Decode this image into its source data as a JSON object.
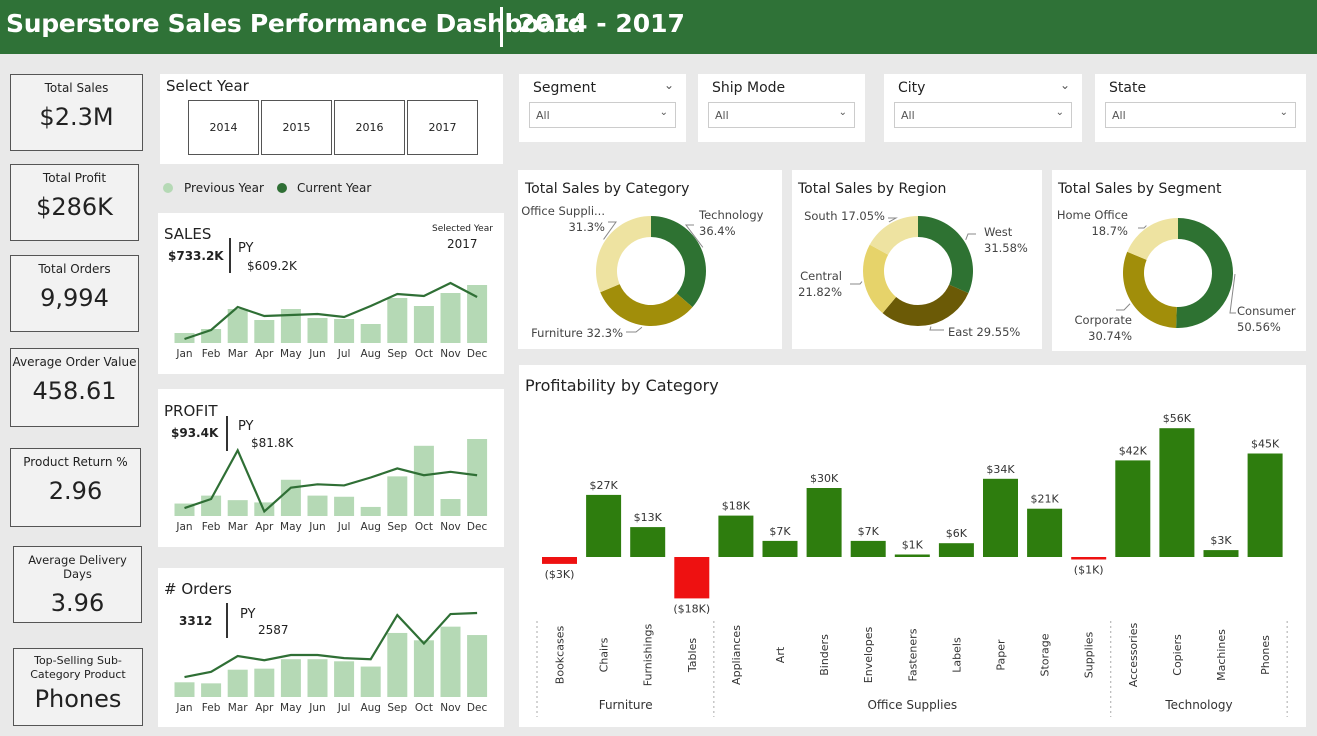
{
  "header": {
    "title": "Superstore Sales Performance Dashboard",
    "years": "2014 - 2017"
  },
  "kpis": [
    {
      "label": "Total Sales",
      "value": "$2.3M"
    },
    {
      "label": "Total Profit",
      "value": "$286K"
    },
    {
      "label": "Total Orders",
      "value": "9,994"
    },
    {
      "label": "Average Order Value",
      "value": "458.61"
    },
    {
      "label": "Product Return %",
      "value": "2.96"
    },
    {
      "label": "Average Delivery Days",
      "value": "3.96"
    },
    {
      "label": "Top-Selling Sub-Category Product",
      "value": "Phones"
    }
  ],
  "year_select": {
    "title": "Select Year",
    "years": [
      "2014",
      "2015",
      "2016",
      "2017"
    ]
  },
  "legend": {
    "previous": "Previous Year",
    "current": "Current Year",
    "previous_color": "#b5d9b5",
    "current_color": "#2f6f35"
  },
  "filters": [
    {
      "label": "Segment",
      "value": "All"
    },
    {
      "label": "Ship Mode",
      "value": "All"
    },
    {
      "label": "City",
      "value": "All"
    },
    {
      "label": "State",
      "value": "All"
    }
  ],
  "monthly": {
    "months": [
      "Jan",
      "Feb",
      "Mar",
      "Apr",
      "May",
      "Jun",
      "Jul",
      "Aug",
      "Sep",
      "Oct",
      "Nov",
      "Dec"
    ],
    "sales": {
      "title": "SALES",
      "current": "$733.2K",
      "py_label": "PY",
      "py": "$609.2K",
      "selected_label": "Selected Year",
      "selected": "2017",
      "bars": [
        10,
        14,
        34,
        23,
        34,
        25,
        24,
        19,
        45,
        37,
        50,
        58
      ],
      "line": [
        4,
        13,
        36,
        27,
        28,
        29,
        26,
        37,
        49,
        47,
        60,
        46
      ]
    },
    "profit": {
      "title": "PROFIT",
      "current": "$93.4K",
      "py_label": "PY",
      "py": "$81.8K",
      "bars": [
        11,
        18,
        14,
        12,
        32,
        18,
        17,
        8,
        35,
        62,
        15,
        68
      ],
      "line": [
        7,
        15,
        58,
        4,
        25,
        28,
        27,
        34,
        42,
        36,
        39,
        36
      ]
    },
    "orders": {
      "title": "# Orders",
      "current": "3312",
      "py_label": "PY",
      "py": "2587",
      "bars": [
        14,
        13,
        26,
        27,
        36,
        36,
        34,
        29,
        61,
        54,
        67,
        59
      ],
      "line": [
        19,
        24,
        39,
        35,
        40,
        40,
        37,
        36,
        78,
        51,
        79,
        80
      ]
    }
  },
  "chart_data": [
    {
      "type": "pie",
      "title": "Total Sales by Category",
      "slices": [
        {
          "label": "Technology",
          "pct": 36.4,
          "color": "#2e7232"
        },
        {
          "label": "Furniture",
          "pct": 32.3,
          "color": "#a18e0a"
        },
        {
          "label": "Office Suppli...",
          "pct": 31.3,
          "color": "#eee3a1"
        }
      ]
    },
    {
      "type": "pie",
      "title": "Total Sales by Region",
      "slices": [
        {
          "label": "West",
          "pct": 31.58,
          "color": "#2e7232"
        },
        {
          "label": "East",
          "pct": 29.55,
          "color": "#6b5a06"
        },
        {
          "label": "Central",
          "pct": 21.82,
          "color": "#e6d36a"
        },
        {
          "label": "South",
          "pct": 17.05,
          "color": "#eee3a1"
        }
      ]
    },
    {
      "type": "pie",
      "title": "Total Sales by Segment",
      "slices": [
        {
          "label": "Consumer",
          "pct": 50.56,
          "color": "#2e7232"
        },
        {
          "label": "Corporate",
          "pct": 30.74,
          "color": "#a18e0a"
        },
        {
          "label": "Home Office",
          "pct": 18.7,
          "color": "#eee3a1"
        }
      ]
    },
    {
      "type": "bar",
      "title": "Profitability by Category",
      "categories": [
        "Bookcases",
        "Chairs",
        "Furnishings",
        "Tables",
        "Appliances",
        "Art",
        "Binders",
        "Envelopes",
        "Fasteners",
        "Labels",
        "Paper",
        "Storage",
        "Supplies",
        "Accessories",
        "Copiers",
        "Machines",
        "Phones"
      ],
      "groups": [
        {
          "name": "Furniture",
          "count": 4
        },
        {
          "name": "Office Supplies",
          "count": 9
        },
        {
          "name": "Technology",
          "count": 4
        }
      ],
      "values": [
        -3,
        27,
        13,
        -18,
        18,
        7,
        30,
        7,
        1,
        6,
        34,
        21,
        -1,
        42,
        56,
        3,
        45
      ],
      "labels": [
        "($3K)",
        "$27K",
        "$13K",
        "($18K)",
        "$18K",
        "$7K",
        "$30K",
        "$7K",
        "$1K",
        "$6K",
        "$34K",
        "$21K",
        "($1K)",
        "$42K",
        "$56K",
        "$3K",
        "$45K"
      ],
      "positive_color": "#2e7d0e",
      "negative_color": "#ee1111"
    }
  ]
}
